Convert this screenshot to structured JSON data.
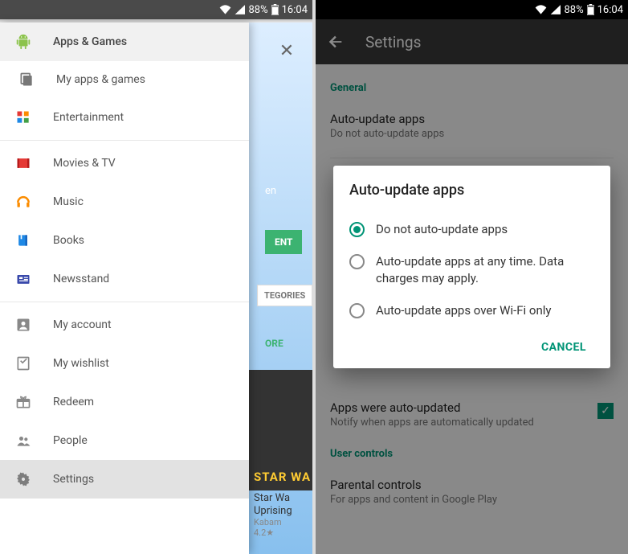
{
  "status": {
    "battery_pct": "88%",
    "time": "16:04"
  },
  "left": {
    "drawer": {
      "apps_games": "Apps & Games",
      "my_apps": "My apps & games",
      "entertainment": "Entertainment",
      "movies_tv": "Movies & TV",
      "music": "Music",
      "books": "Books",
      "newsstand": "Newsstand",
      "my_account": "My account",
      "my_wishlist": "My wishlist",
      "redeem": "Redeem",
      "people": "People",
      "settings": "Settings"
    },
    "bg": {
      "en_fragment": "en",
      "ent_fragment": "ENT",
      "categories_fragment": "TEGORIES",
      "ore_fragment": "ORE",
      "card_fragment": "STAR WA",
      "title_line1": "Star Wa",
      "title_line2": "Uprising",
      "title_line3": "Kabam",
      "rating_fragment": "4.2★"
    }
  },
  "right": {
    "appbar": {
      "title": "Settings"
    },
    "sections": {
      "general": "General",
      "user_controls": "User controls"
    },
    "rows": {
      "auto_update": {
        "title": "Auto-update apps",
        "sub": "Do not auto-update apps"
      },
      "apps_were": {
        "title": "Apps were auto-updated",
        "sub": "Notify when apps are automatically updated"
      },
      "parental": {
        "title": "Parental controls",
        "sub": "For apps and content in Google Play"
      }
    },
    "dialog": {
      "title": "Auto-update apps",
      "opt1": "Do not auto-update apps",
      "opt2": "Auto-update apps at any time. Data charges may apply.",
      "opt3": "Auto-update apps over Wi-Fi only",
      "cancel": "CANCEL",
      "selected": "opt1"
    }
  }
}
